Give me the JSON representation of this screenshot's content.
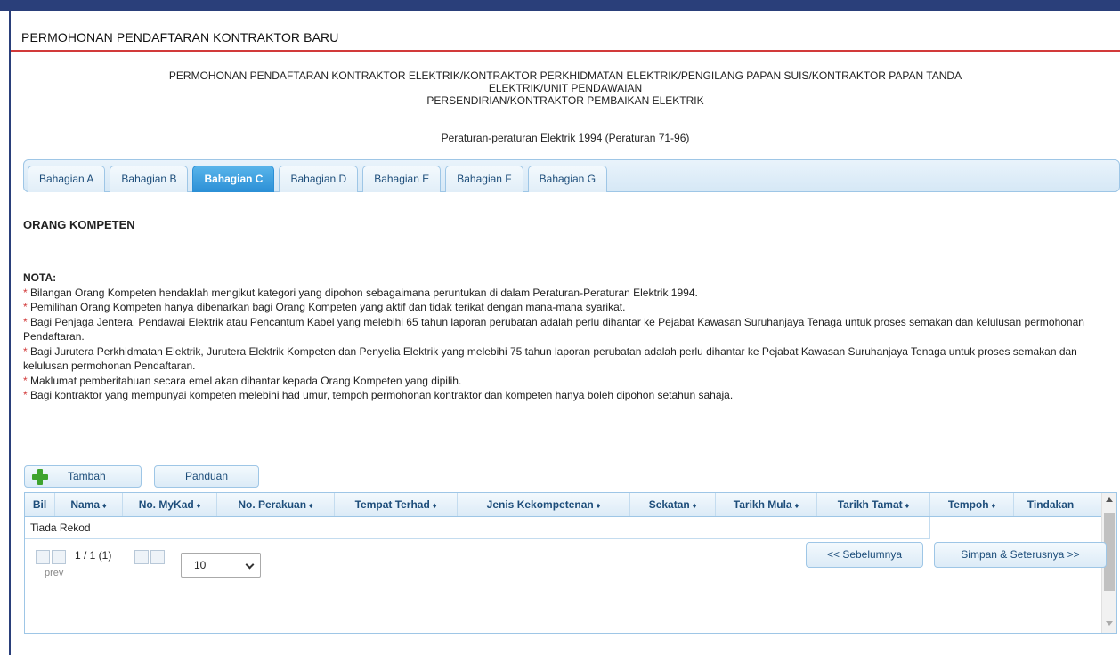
{
  "header": {
    "title": "PERMOHONAN PENDAFTARAN KONTRAKTOR BARU"
  },
  "form": {
    "title_line1": "PERMOHONAN PENDAFTARAN KONTRAKTOR ELEKTRIK/KONTRAKTOR PERKHIDMATAN ELEKTRIK/PENGILANG PAPAN SUIS/KONTRAKTOR PAPAN TANDA",
    "title_line2": "ELEKTRIK/UNIT PENDAWAIAN",
    "title_line3": "PERSENDIRIAN/KONTRAKTOR PEMBAIKAN ELEKTRIK",
    "regulation": "Peraturan-peraturan Elektrik 1994 (Peraturan 71-96)"
  },
  "tabs": [
    {
      "label": "Bahagian A",
      "active": false
    },
    {
      "label": "Bahagian B",
      "active": false
    },
    {
      "label": "Bahagian C",
      "active": true
    },
    {
      "label": "Bahagian D",
      "active": false
    },
    {
      "label": "Bahagian E",
      "active": false
    },
    {
      "label": "Bahagian F",
      "active": false
    },
    {
      "label": "Bahagian G",
      "active": false
    }
  ],
  "section": {
    "title": "ORANG KOMPETEN"
  },
  "nota": {
    "label": "NOTA:",
    "items": [
      "Bilangan Orang Kompeten hendaklah mengikut kategori yang dipohon sebagaimana peruntukan di dalam Peraturan-Peraturan Elektrik 1994.",
      "Pemilihan Orang Kompeten hanya dibenarkan bagi Orang Kompeten yang aktif dan tidak terikat dengan mana-mana syarikat.",
      "Bagi Penjaga Jentera, Pendawai Elektrik atau Pencantum Kabel yang melebihi 65 tahun laporan perubatan adalah perlu dihantar ke Pejabat Kawasan Suruhanjaya Tenaga untuk proses semakan dan kelulusan permohonan Pendaftaran.",
      "Bagi Jurutera Perkhidmatan Elektrik, Jurutera Elektrik Kompeten dan Penyelia Elektrik yang melebihi 75 tahun laporan perubatan adalah perlu dihantar ke Pejabat Kawasan Suruhanjaya Tenaga untuk proses semakan dan kelulusan permohonan Pendaftaran.",
      "Maklumat pemberitahuan secara emel akan dihantar kepada Orang Kompeten yang dipilih.",
      "Bagi kontraktor yang mempunyai kompeten melebihi had umur, tempoh permohonan kontraktor dan kompeten hanya boleh dipohon setahun sahaja."
    ]
  },
  "toolbar": {
    "add_label": "Tambah",
    "guide_label": "Panduan"
  },
  "table": {
    "columns": [
      "Bil",
      "Nama",
      "No. MyKad",
      "No. Perakuan",
      "Tempat Terhad",
      "Jenis Kekompetenan",
      "Sekatan",
      "Tarikh Mula",
      "Tarikh Tamat",
      "Tempoh",
      "Tindakan"
    ],
    "sort_glyph": "♦",
    "empty_text": "Tiada Rekod"
  },
  "pager": {
    "prev_label": "prev",
    "page_info": "1 / 1 (1)",
    "rows_per_page": "10"
  },
  "footer": {
    "prev_button": "<< Sebelumnya",
    "next_button": "Simpan & Seterusnya >>"
  },
  "colors": {
    "accent": "#2b8fd6",
    "header_line": "#d23a3a",
    "top_bar": "#2a3f7a",
    "add_icon": "#3fa32e"
  }
}
